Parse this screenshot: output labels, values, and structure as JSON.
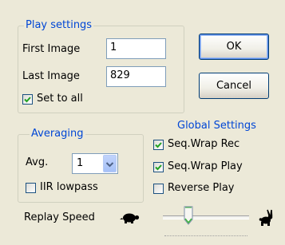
{
  "play_settings": {
    "legend": "Play settings",
    "first_image_label": "First Image",
    "first_image_value": "1",
    "last_image_label": "Last Image",
    "last_image_value": "829",
    "set_to_all_label": "Set to all",
    "set_to_all_checked": true
  },
  "buttons": {
    "ok": "OK",
    "cancel": "Cancel"
  },
  "averaging": {
    "legend": "Averaging",
    "avg_label": "Avg.",
    "avg_value": "1",
    "iir_label": "IIR lowpass",
    "iir_checked": false
  },
  "global_settings": {
    "legend": "Global Settings",
    "seq_wrap_rec_label": "Seq.Wrap Rec",
    "seq_wrap_rec_checked": true,
    "seq_wrap_play_label": "Seq.Wrap Play",
    "seq_wrap_play_checked": true,
    "reverse_play_label": "Reverse Play",
    "reverse_play_checked": false
  },
  "replay_speed": {
    "label": "Replay Speed",
    "slow_icon": "turtle-icon",
    "fast_icon": "rabbit-icon",
    "level": 0.33
  },
  "colors": {
    "legend": "#0046d5",
    "check": "#21a121",
    "background": "#ece9d8"
  }
}
